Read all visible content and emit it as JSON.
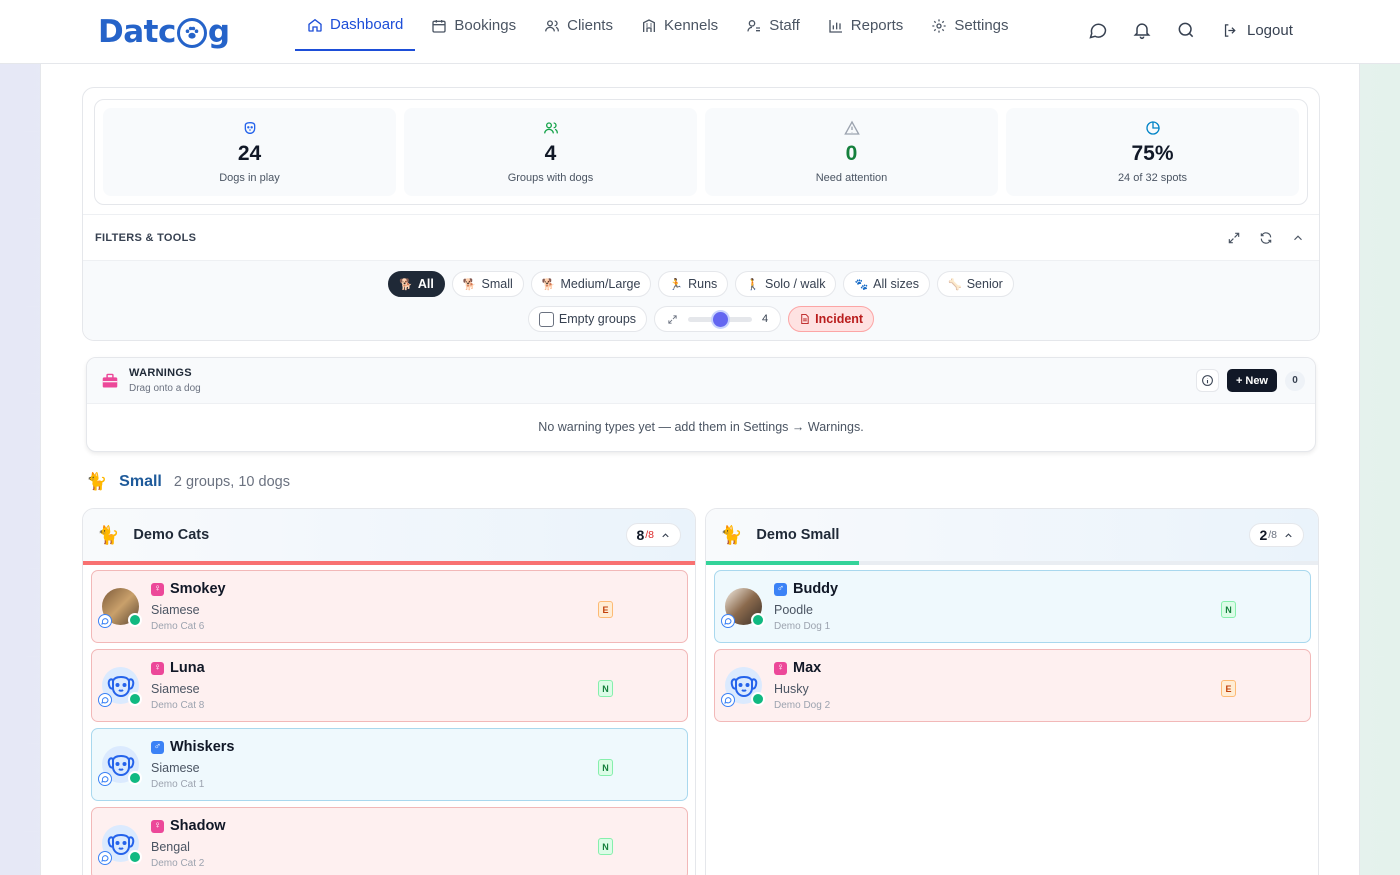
{
  "app": {
    "logo_left": "Datc",
    "logo_right": "g"
  },
  "nav": {
    "items": [
      {
        "label": "Dashboard",
        "icon": "home-icon",
        "active": true
      },
      {
        "label": "Bookings",
        "icon": "calendar-icon"
      },
      {
        "label": "Clients",
        "icon": "users-icon"
      },
      {
        "label": "Kennels",
        "icon": "building-icon"
      },
      {
        "label": "Staff",
        "icon": "staff-icon"
      },
      {
        "label": "Reports",
        "icon": "chart-icon"
      },
      {
        "label": "Settings",
        "icon": "gear-icon"
      }
    ],
    "logout": "Logout"
  },
  "stats": [
    {
      "value": "24",
      "label": "Dogs in play",
      "icon": "dog-icon",
      "color": "#2563eb"
    },
    {
      "value": "4",
      "label": "Groups with dogs",
      "icon": "users-icon",
      "color": "#16a34a"
    },
    {
      "value": "0",
      "label": "Need attention",
      "icon": "warning-icon",
      "color": "#9ca3af",
      "value_color": "#15803d"
    },
    {
      "value": "75%",
      "label": "24 of 32 spots",
      "icon": "pie-icon",
      "color": "#0284c7"
    }
  ],
  "filters": {
    "title": "FILTERS & TOOLS",
    "chips": [
      {
        "label": "All",
        "emoji": "🐕",
        "active": true
      },
      {
        "label": "Small",
        "emoji": "🐕"
      },
      {
        "label": "Medium/Large",
        "emoji": "🐕"
      },
      {
        "label": "Runs",
        "emoji": "🏃"
      },
      {
        "label": "Solo / walk",
        "emoji": "🚶"
      },
      {
        "label": "All sizes",
        "emoji": "🐾"
      },
      {
        "label": "Senior",
        "emoji": "🦴"
      }
    ],
    "empty_groups": "Empty groups",
    "zoom_value": "4",
    "zoom_level": 0.5,
    "incident": "Incident"
  },
  "warnings": {
    "title": "WARNINGS",
    "subtitle": "Drag onto a dog",
    "new_label": "New",
    "count": "0",
    "empty": "No warning types yet — add them in Settings → Warnings."
  },
  "section": {
    "emoji": "🐈",
    "title": "Small",
    "subtitle": "2 groups, 10 dogs"
  },
  "groups": [
    {
      "name": "Demo Cats",
      "emoji": "🐈",
      "count": "8",
      "max": "/8",
      "count_color": "#111827",
      "max_color": "#dc2626",
      "fill_fraction": 1.0,
      "fill_color": "#f87171",
      "pets": [
        {
          "name": "Smokey",
          "gender": "♀",
          "breed": "Siamese",
          "tag": "Demo Cat 6",
          "badge": "E",
          "photo": true
        },
        {
          "name": "Luna",
          "gender": "♀",
          "breed": "Siamese",
          "tag": "Demo Cat 8",
          "badge": "N"
        },
        {
          "name": "Whiskers",
          "gender": "♂",
          "breed": "Siamese",
          "tag": "Demo Cat 1",
          "badge": "N"
        },
        {
          "name": "Shadow",
          "gender": "♀",
          "breed": "Bengal",
          "tag": "Demo Cat 2",
          "badge": "N"
        }
      ]
    },
    {
      "name": "Demo Small",
      "emoji": "🐈",
      "count": "2",
      "max": "/8",
      "count_color": "#111827",
      "max_color": "#6b7280",
      "fill_fraction": 0.25,
      "fill_color": "#34d399",
      "pets": [
        {
          "name": "Buddy",
          "gender": "♂",
          "breed": "Poodle",
          "tag": "Demo Dog 1",
          "badge": "N",
          "photo": true
        },
        {
          "name": "Max",
          "gender": "♀",
          "breed": "Husky",
          "tag": "Demo Dog 2",
          "badge": "E"
        }
      ]
    }
  ]
}
